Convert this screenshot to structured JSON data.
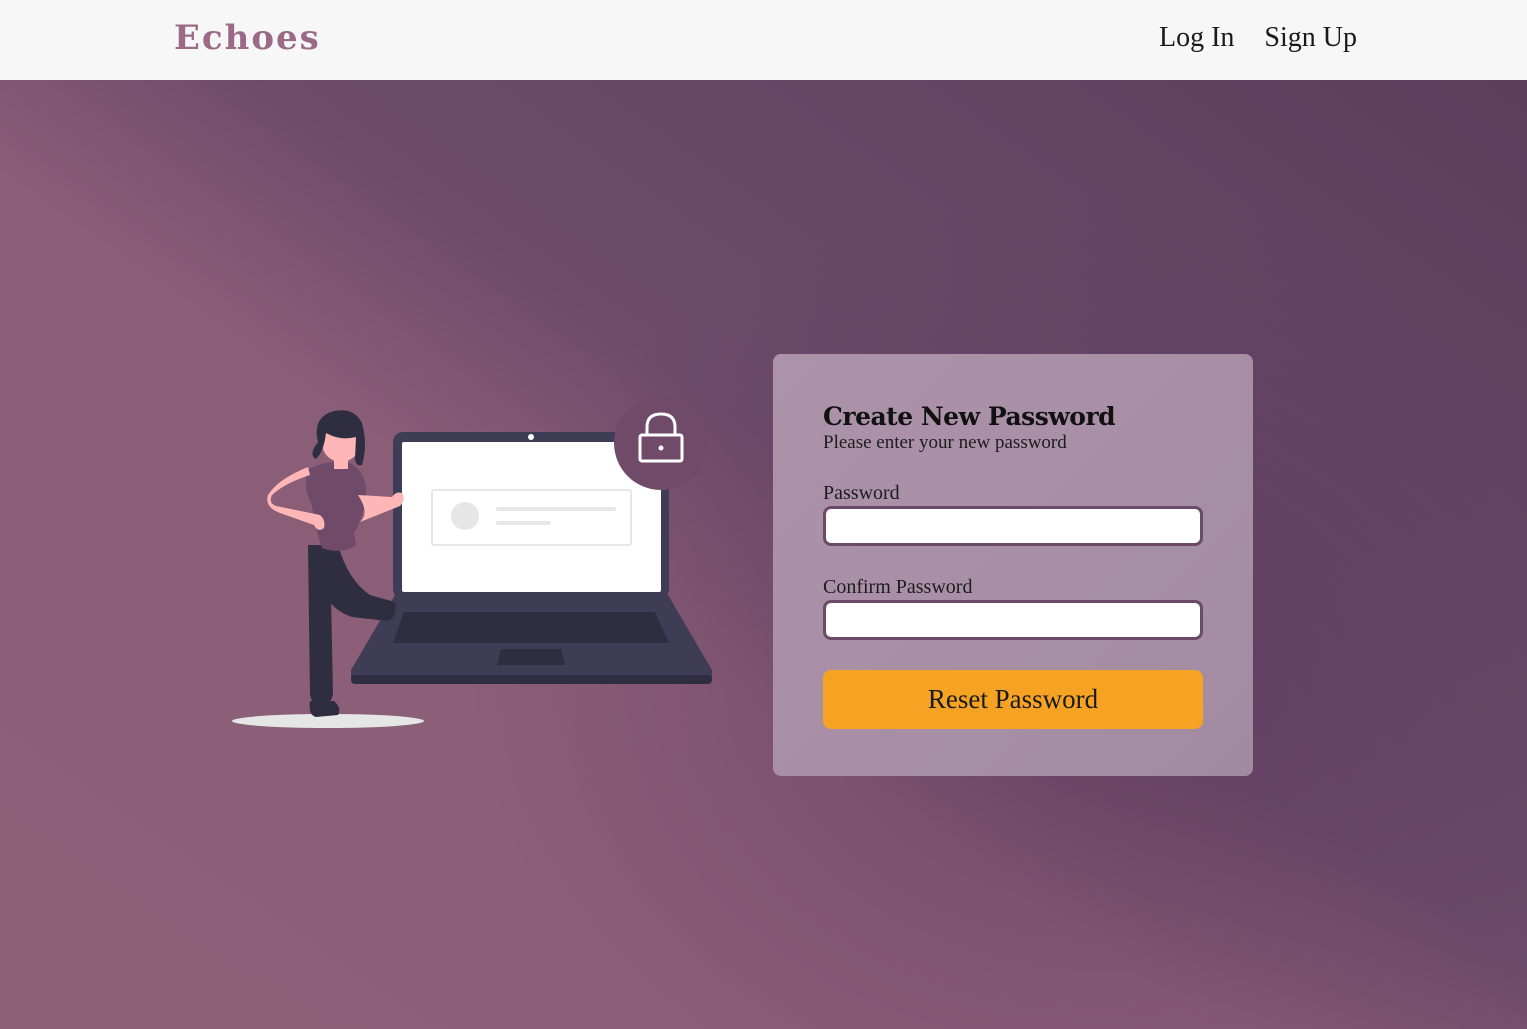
{
  "nav": {
    "brand": "Echoes",
    "login_label": "Log In",
    "signup_label": "Sign Up"
  },
  "form": {
    "title": "Create New Password",
    "subtitle": "Please enter your new password",
    "password_label": "Password",
    "password_value": "",
    "confirm_label": "Confirm Password",
    "confirm_value": "",
    "submit_label": "Reset Password"
  },
  "illustration": {
    "icon": "lock-icon"
  },
  "colors": {
    "brand": "#9a6a86",
    "accent_button": "#f6a324",
    "input_border": "#6a4a67",
    "background": "#8b5e78",
    "card": "#a88fa5"
  }
}
